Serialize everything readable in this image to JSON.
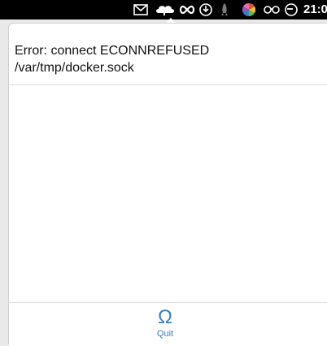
{
  "menubar": {
    "icons": [
      "mail-icon",
      "cloud-sync-icon",
      "infinity-icon",
      "download-icon",
      "rocket-icon",
      "color-wheel-icon",
      "glasses-icon",
      "time-machine-icon"
    ],
    "clock": "21:0"
  },
  "popover": {
    "error_lines": [
      "Error: connect ECONNREFUSED",
      "/var/tmp/docker.sock"
    ]
  },
  "footer": {
    "quit_icon_glyph": "Ω",
    "quit_label": "Quit",
    "accent_color": "#3a7fc1"
  }
}
